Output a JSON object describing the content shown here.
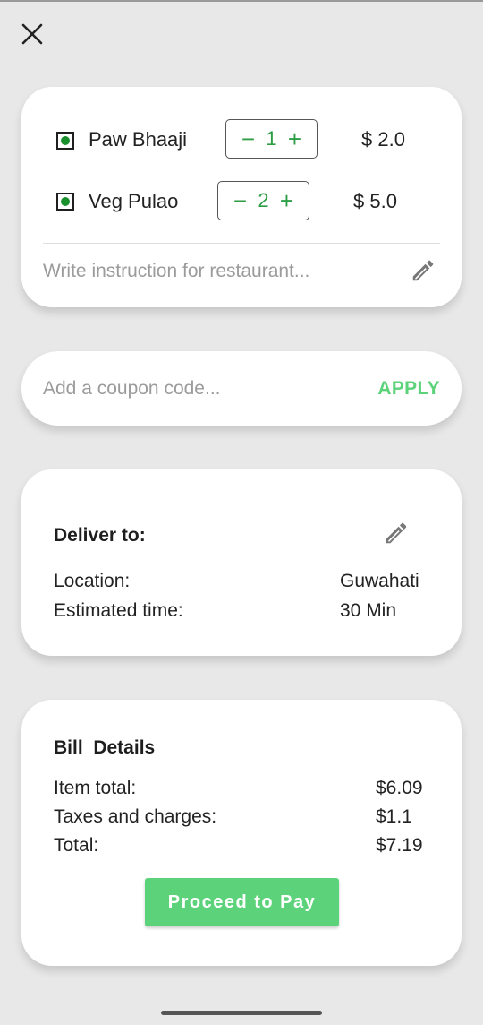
{
  "cart": {
    "items": [
      {
        "name": "Paw Bhaaji",
        "qty": "1",
        "price": "$ 2.0"
      },
      {
        "name": "Veg Pulao",
        "qty": "2",
        "price": "$ 5.0"
      }
    ],
    "decrement_symbol": "−",
    "increment_symbol": "+",
    "instruction_placeholder": "Write instruction for restaurant..."
  },
  "coupon": {
    "placeholder": "Add a coupon code...",
    "apply_label": "APPLY"
  },
  "delivery": {
    "title": "Deliver to:",
    "location_label": "Location:",
    "location_value": "Guwahati",
    "time_label": "Estimated time:",
    "time_value": "30 Min"
  },
  "bill": {
    "title": "Bill  Details",
    "rows": [
      {
        "label": "Item total:",
        "value": "$6.09"
      },
      {
        "label": "Taxes and charges:",
        "value": "$1.1"
      },
      {
        "label": "Total:",
        "value": "$7.19"
      }
    ],
    "pay_label": "Proceed to Pay"
  },
  "colors": {
    "accent": "#5cd37a",
    "veg_dot": "#1a8f2e",
    "background": "#e8e8e8"
  },
  "icons": {
    "close": "close-icon",
    "edit": "pencil-icon",
    "veg": "veg-indicator-icon"
  }
}
